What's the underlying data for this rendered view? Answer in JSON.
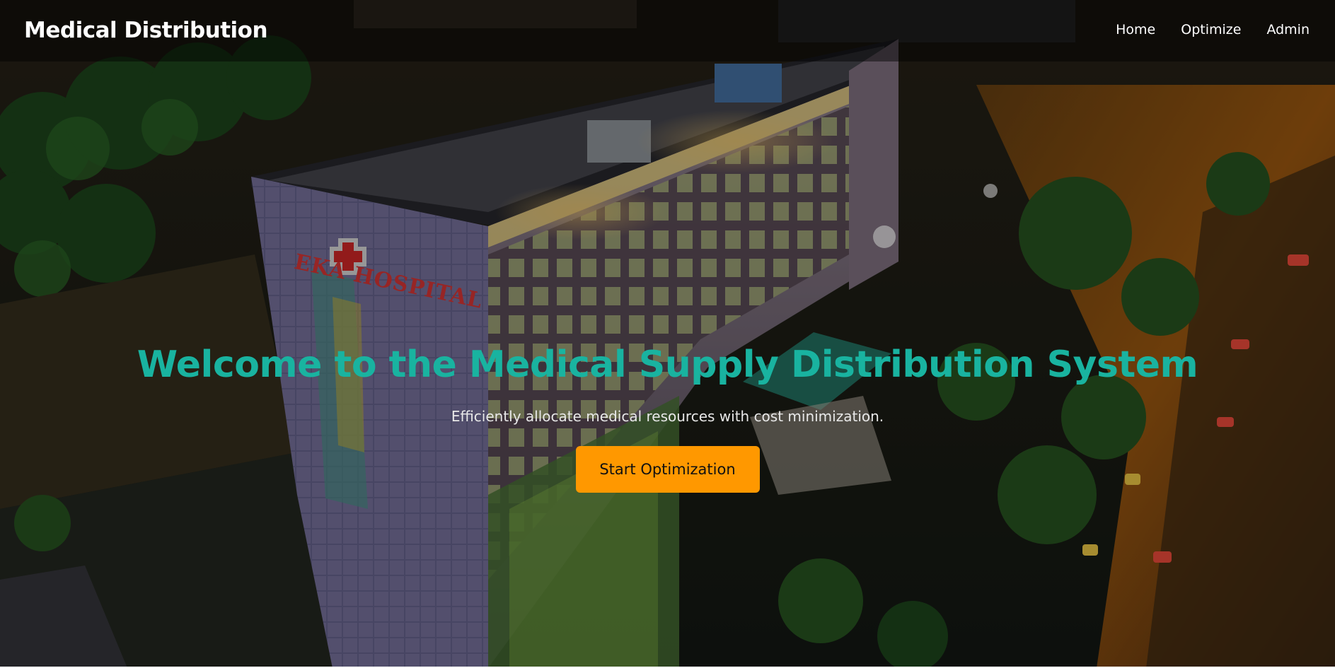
{
  "navbar": {
    "brand": "Medical Distribution",
    "links": [
      {
        "label": "Home"
      },
      {
        "label": "Optimize"
      },
      {
        "label": "Admin"
      }
    ]
  },
  "hero": {
    "title": "Welcome to the Medical Supply Distribution System",
    "subtitle": "Efficiently allocate medical resources with cost minimization.",
    "cta_label": "Start Optimization",
    "background": "night aerial photo of hospital building",
    "building_sign": "EKA HOSPITAL"
  },
  "colors": {
    "accent_teal": "#19b3a0",
    "cta_orange": "#ff9800",
    "navbar_overlay": "rgba(0,0,0,0.45)"
  }
}
